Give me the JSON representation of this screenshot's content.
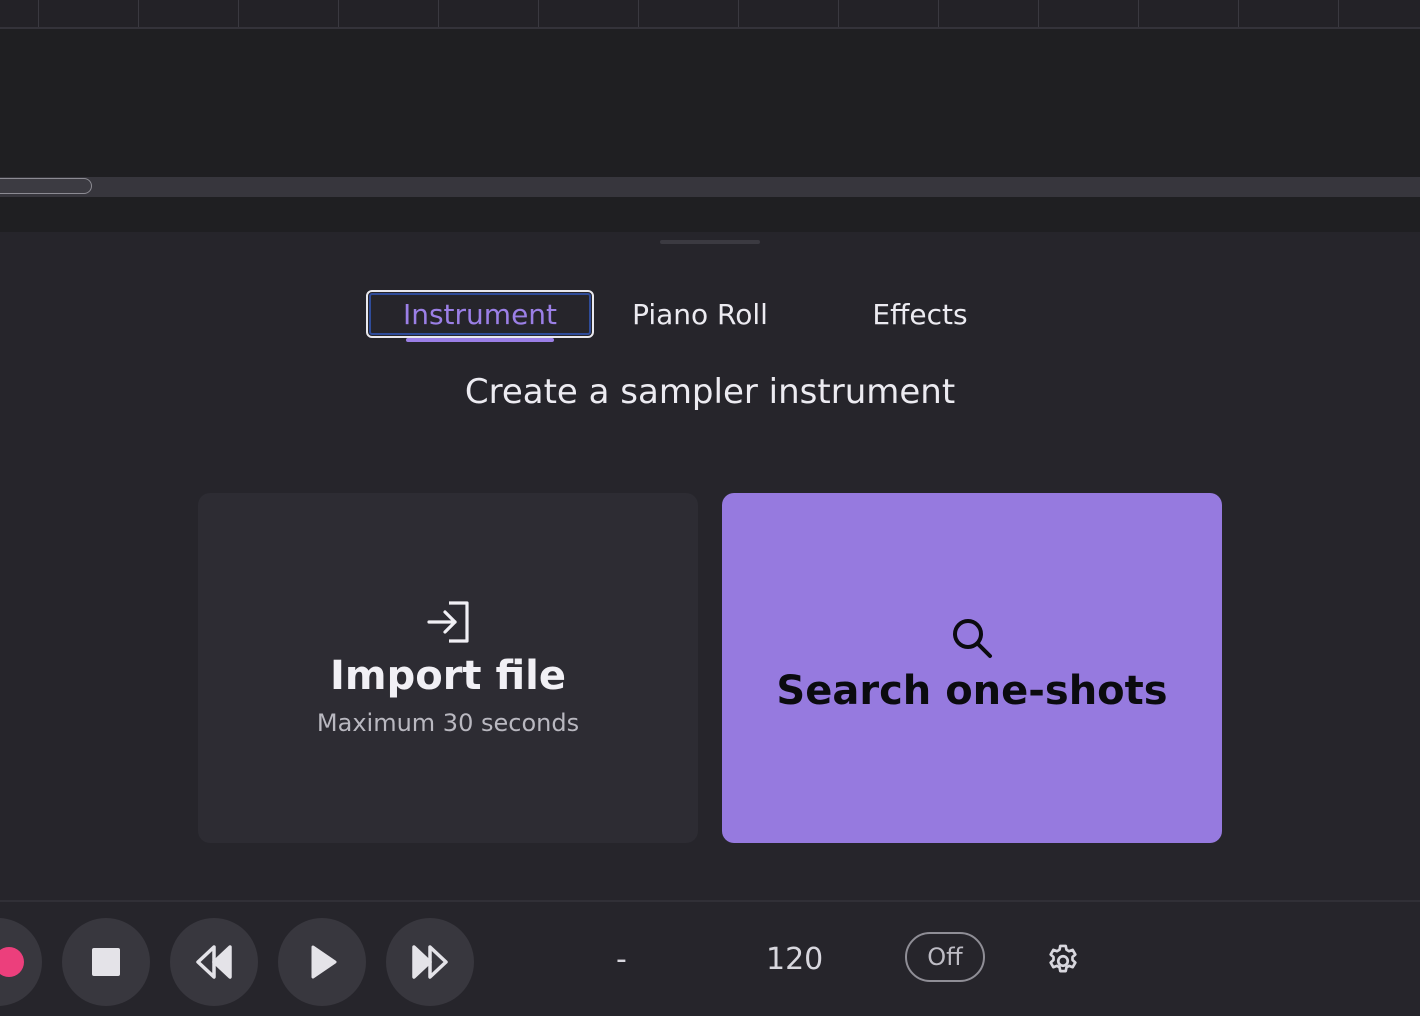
{
  "tabs": [
    {
      "label": "Instrument",
      "active": true
    },
    {
      "label": "Piano Roll",
      "active": false
    },
    {
      "label": "Effects",
      "active": false
    }
  ],
  "panel": {
    "title": "Create a sampler instrument"
  },
  "cards": {
    "import": {
      "icon": "import-file-icon",
      "title": "Import file",
      "subtitle": "Maximum 30 seconds"
    },
    "search": {
      "icon": "search-icon",
      "title": "Search one-shots"
    }
  },
  "transport": {
    "position": "-",
    "tempo": "120",
    "metronome": "Off"
  },
  "colors": {
    "accent": "#967adf",
    "record": "#ec3f7c",
    "background": "#26252b"
  }
}
